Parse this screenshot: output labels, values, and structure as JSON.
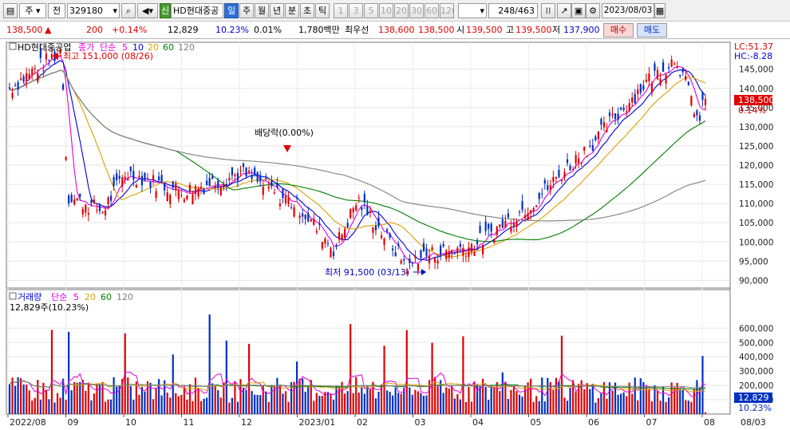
{
  "toolbar": {
    "market": "주",
    "type": "전",
    "code": "329180",
    "credit_badge": "신",
    "name": "HD현대중공",
    "periods": [
      "일",
      "주",
      "월",
      "년",
      "분",
      "초",
      "틱"
    ],
    "active_period": "일",
    "minutes": [
      "1",
      "3",
      "5",
      "10",
      "20",
      "30",
      "60",
      "120"
    ],
    "count": "248",
    "total": "/463",
    "date": "2023/08/03"
  },
  "quote": {
    "price": "138,500",
    "change_arrow": "▲",
    "change": "200",
    "change_pct": "+0.14%",
    "volume": "12,829",
    "volume_ratio": "10.23%",
    "turnover": "0.01%",
    "amount": "1,780백만",
    "ask_label": "최우선",
    "ask1": "138,600",
    "bid1": "138,500",
    "open_label": "시",
    "open": "139,500",
    "high_label": "고",
    "high": "139,500",
    "low_label": "저",
    "low": "137,900",
    "buy_label": "매수",
    "sell_label": "매도"
  },
  "price_panel": {
    "legend_name": "HD현대중공업",
    "legend_close": "종가",
    "legend_simple": "단순",
    "ma": [
      "5",
      "10",
      "20",
      "60",
      "120"
    ],
    "ma_colors": [
      "#e000e0",
      "#0000e0",
      "#e0a000",
      "#008000",
      "#808080"
    ],
    "lc": "LC:51.37",
    "hc": "HC:-8.28",
    "max_note": "최고 151,000 (08/26)",
    "min_note": "최저 91,500 (03/13)",
    "dividend_note": "배당락(0.00%)",
    "last_price": "138,500",
    "last_pct": "0.14%",
    "yticks": [
      "145,000",
      "140,000",
      "135,000",
      "130,000",
      "125,000",
      "120,000",
      "115,000",
      "110,000",
      "105,000",
      "100,000",
      "95,000",
      "90,000"
    ]
  },
  "volume_panel": {
    "legend_name": "거래량",
    "legend_simple": "단순",
    "ma": [
      "5",
      "20",
      "60",
      "120"
    ],
    "ma_colors": [
      "#e000e0",
      "#e0a000",
      "#008000",
      "#808080"
    ],
    "current": "12,829주(10.23%)",
    "last_volume": "12,829",
    "last_pct": "10.23%",
    "yticks": [
      "600,000",
      "500,000",
      "400,000",
      "300,000",
      "200,000",
      "100,000"
    ]
  },
  "x_axis": {
    "labels": [
      "2022/08",
      "09",
      "10",
      "11",
      "12",
      "2023/01",
      "02",
      "03",
      "04",
      "05",
      "06",
      "07",
      "08"
    ],
    "right_label": "08/03"
  },
  "chart_data": {
    "type": "candlestick",
    "y_range_price": [
      88000,
      152000
    ],
    "y_range_volume": [
      0,
      680000
    ],
    "monthly_close_approx": [
      {
        "x": "2022/08",
        "close": 140000
      },
      {
        "x": "09",
        "close": 112000
      },
      {
        "x": "10",
        "close": 118000
      },
      {
        "x": "11",
        "close": 113000
      },
      {
        "x": "12",
        "close": 118000
      },
      {
        "x": "2023/01",
        "close": 109000
      },
      {
        "x": "02",
        "close": 111000
      },
      {
        "x": "03",
        "close": 96000
      },
      {
        "x": "04",
        "close": 99000
      },
      {
        "x": "05",
        "close": 110000
      },
      {
        "x": "06",
        "close": 125000
      },
      {
        "x": "07",
        "close": 142000
      },
      {
        "x": "08",
        "close": 138500
      }
    ]
  }
}
